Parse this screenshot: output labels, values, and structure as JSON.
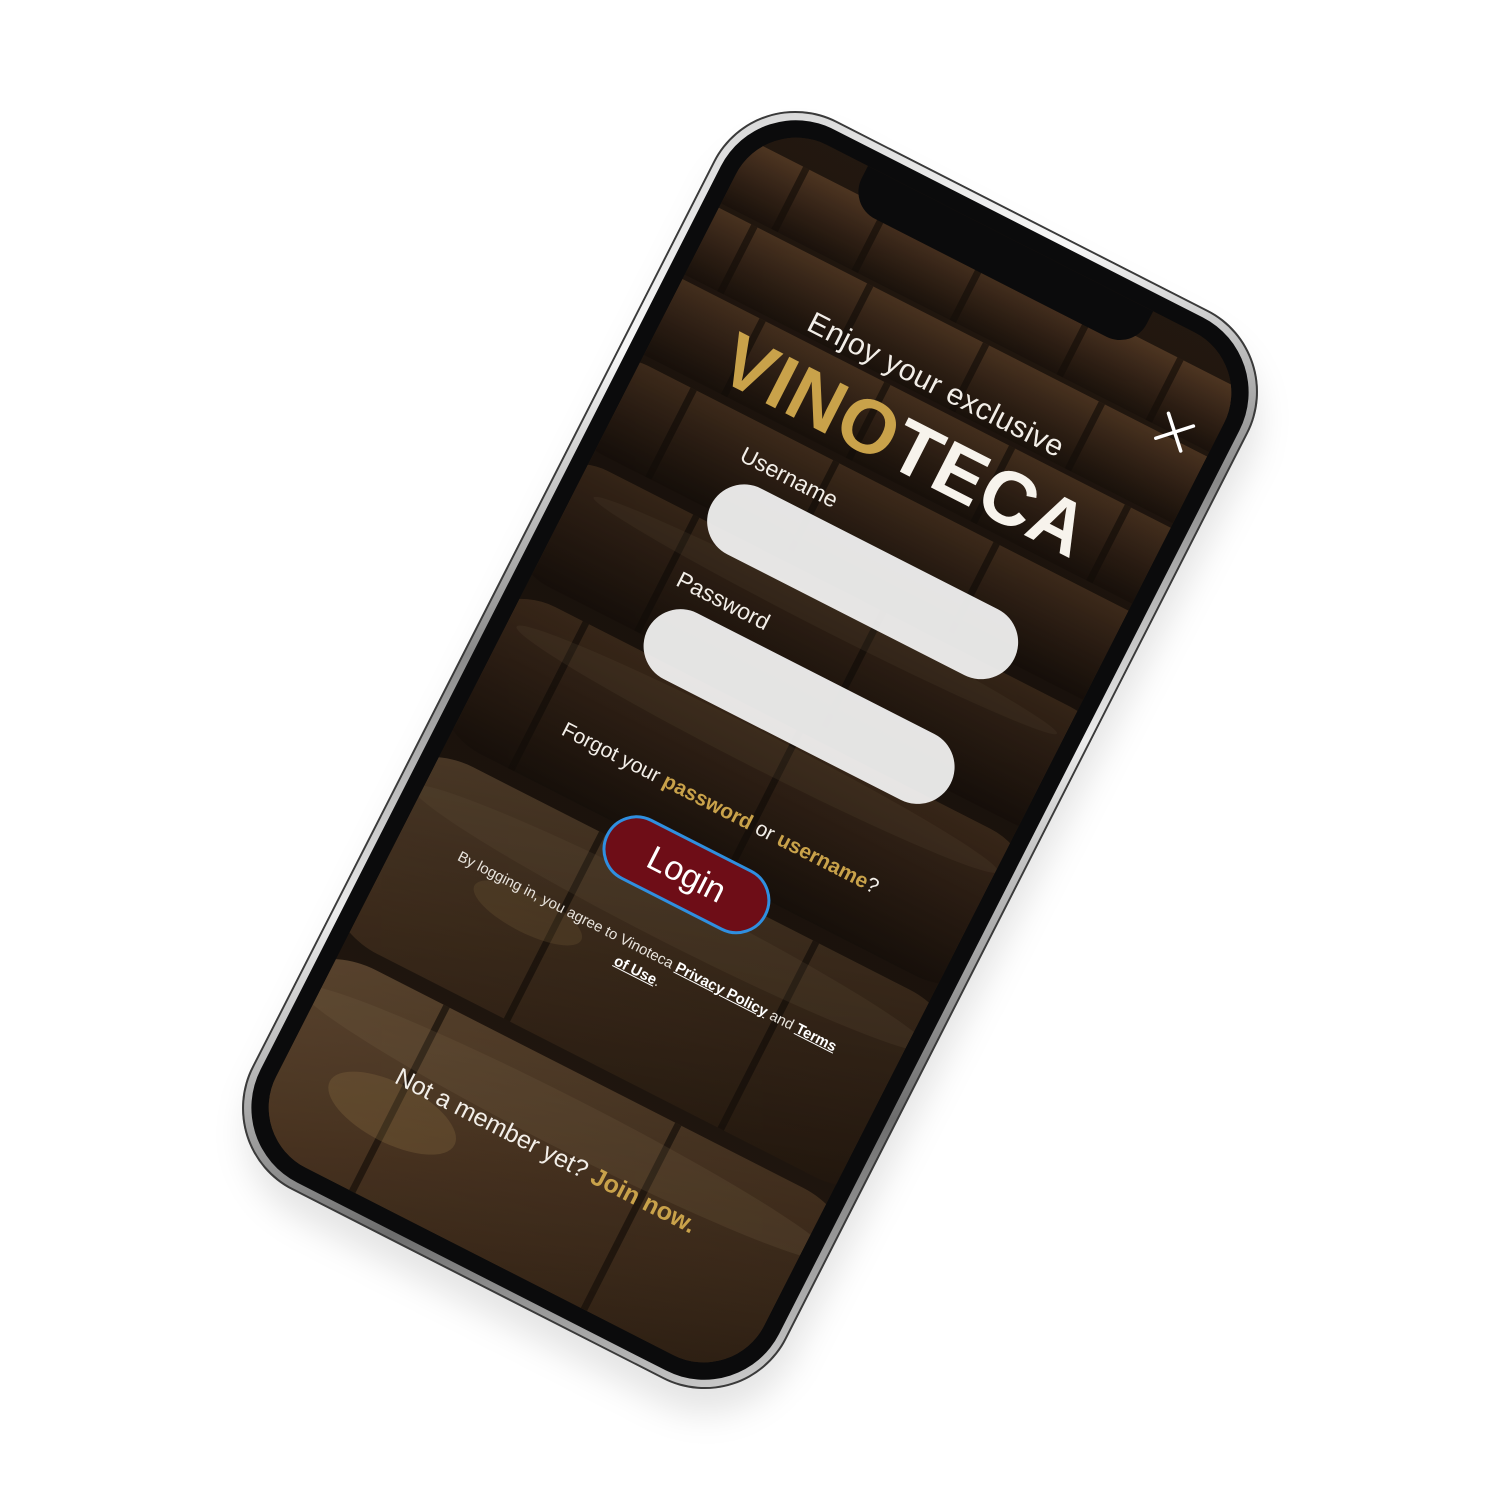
{
  "colors": {
    "accent_gold": "#c9a24a",
    "login_button": "#6e0d17",
    "login_button_border": "#2f8fe0",
    "input_background": "#f4f4f4"
  },
  "header": {
    "close_icon": "close-icon"
  },
  "hero": {
    "tagline": "Enjoy your exclusive",
    "logo_part1": "VINO",
    "logo_part2": "TECA"
  },
  "form": {
    "username_label": "Username",
    "password_label": "Password",
    "username_value": "",
    "password_value": ""
  },
  "forgot": {
    "prefix": "Forgot your",
    "password_link": "password",
    "or": "or",
    "username_link": "username",
    "suffix": "?"
  },
  "login_button_label": "Login",
  "legal": {
    "prefix": "By logging in, you agree to Vinoteca",
    "privacy_link": "Privacy Policy",
    "and": "and",
    "terms_link": "Terms of Use",
    "suffix": "."
  },
  "signup": {
    "prefix": "Not a member yet?",
    "link": "Join now."
  }
}
